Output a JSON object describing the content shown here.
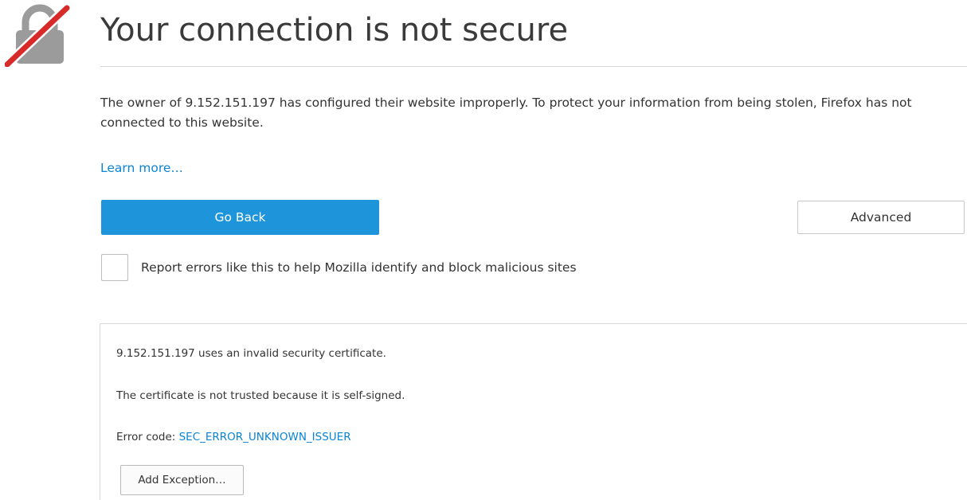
{
  "header": {
    "title": "Your connection is not secure",
    "icon": "broken-lock-icon"
  },
  "description": {
    "text": "The owner of 9.152.151.197 has configured their website improperly. To protect your information from being stolen, Firefox has not connected to this website."
  },
  "learn_more": {
    "label": "Learn more…"
  },
  "buttons": {
    "go_back_label": "Go Back",
    "advanced_label": "Advanced"
  },
  "report": {
    "checked": false,
    "label": "Report errors like this to help Mozilla identify and block malicious sites"
  },
  "advanced_panel": {
    "invalid_cert_text": "9.152.151.197 uses an invalid security certificate.",
    "not_trusted_text": "The certificate is not trusted because it is self-signed.",
    "error_code_prefix": "Error code: ",
    "error_code": "SEC_ERROR_UNKNOWN_ISSUER",
    "add_exception_label": "Add Exception…"
  },
  "colors": {
    "primary_button": "#1e94db",
    "link": "#0a84d6",
    "strike": "#d92a2a",
    "lock_gray": "#9b9b9b"
  }
}
